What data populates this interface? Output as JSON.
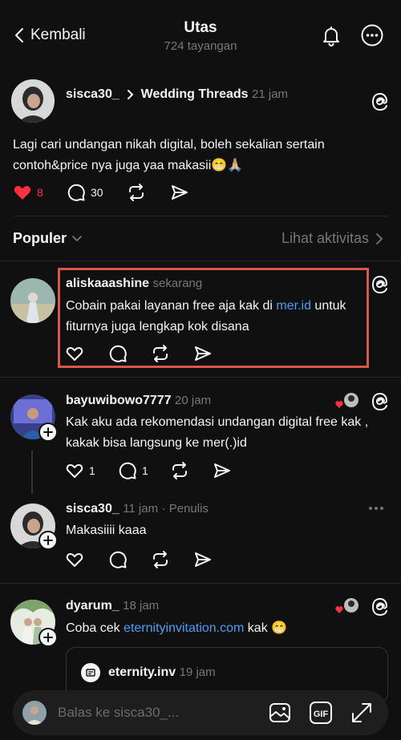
{
  "header": {
    "back_label": "Kembali",
    "title": "Utas",
    "subtitle": "724 tayangan"
  },
  "original_post": {
    "username": "sisca30_",
    "community": "Wedding Threads",
    "time": "21 jam",
    "text": "Lagi cari undangan nikah digital, boleh sekalian sertain contoh&price nya juga yaa makasii😁🙏🏼",
    "likes": "8",
    "replies": "30"
  },
  "sort": {
    "label": "Populer",
    "activity_label": "Lihat aktivitas"
  },
  "replies": [
    {
      "username": "aliskaaashine",
      "time": "sekarang",
      "text_before": "Cobain pakai layanan free aja kak di ",
      "link": "mer.id",
      "text_after": " untuk fiturnya juga lengkap kok disana"
    },
    {
      "username": "bayuwibowo7777",
      "time": "20 jam",
      "text": "Kak aku ada rekomendasi undangan digital free kak , kakak bisa langsung ke mer(.)id",
      "likes": "1",
      "replies": "1"
    },
    {
      "username": "sisca30_",
      "time": "11 jam",
      "author_tag": "· Penulis",
      "text": "Makasiiii kaaa"
    },
    {
      "username": "dyarum_",
      "time": "18 jam",
      "text_before": "Coba cek ",
      "link": "eternityinvitation.com",
      "text_after": " kak 😁",
      "quoted_username": "eternity.inv",
      "quoted_time": "19 jam"
    }
  ],
  "composer": {
    "placeholder": "Balas ke sisca30_..."
  },
  "colors": {
    "background": "#101010",
    "link": "#4a9ff5",
    "like_red": "#ff3040",
    "highlight_box": "#d9574a"
  }
}
